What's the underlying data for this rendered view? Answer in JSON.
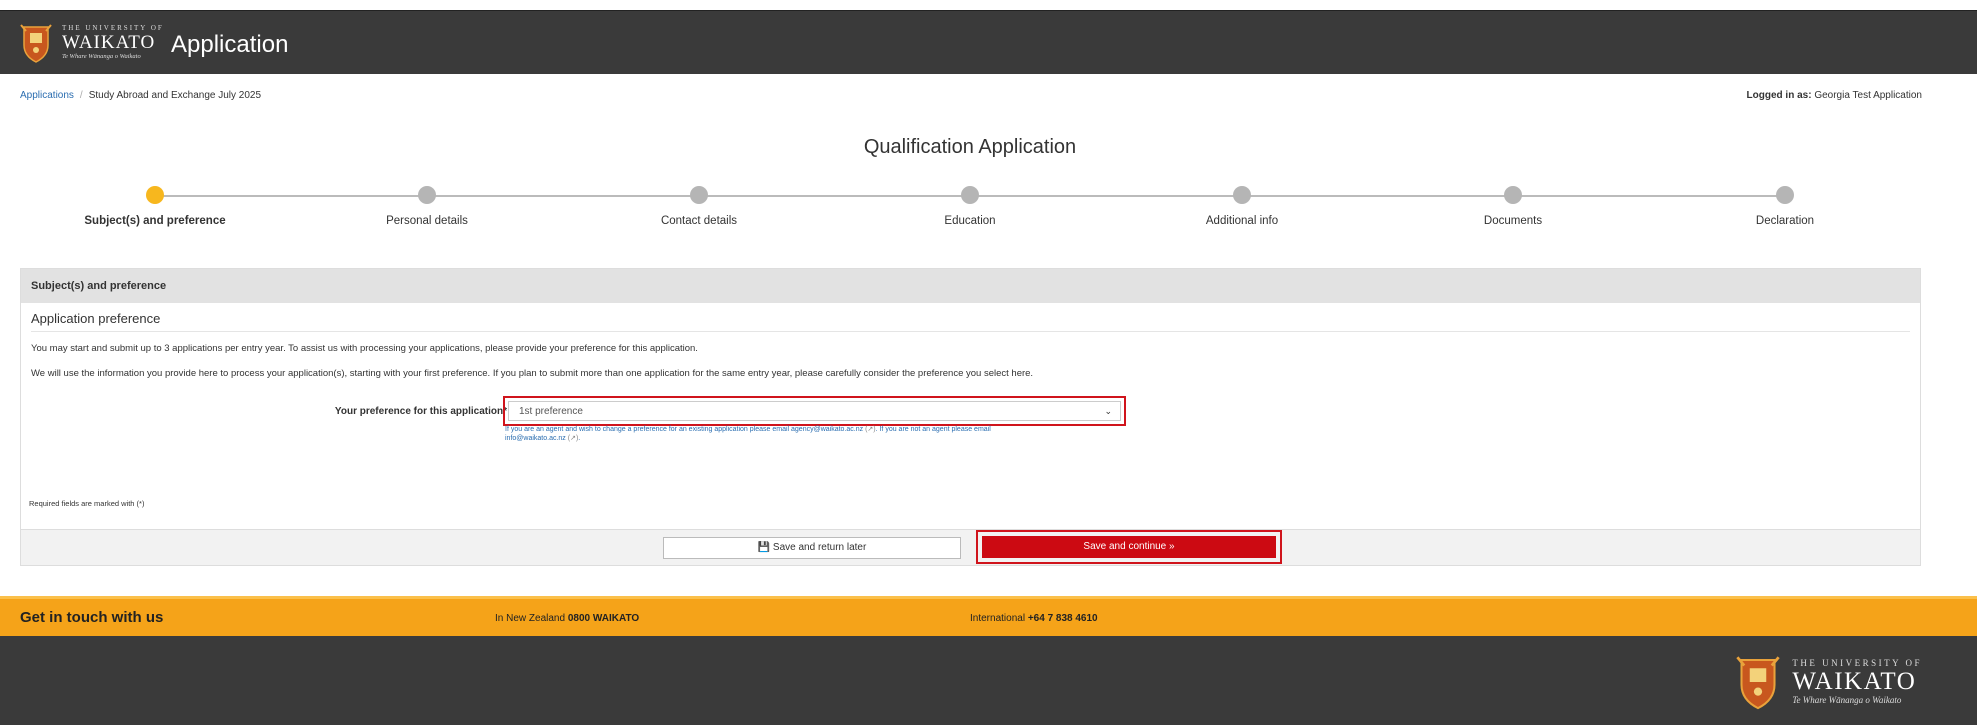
{
  "header": {
    "logo": {
      "small": "THE UNIVERSITY OF",
      "big": "WAIKATO",
      "motto": "Te Whare Wānanga o Waikato"
    },
    "title": "Application"
  },
  "breadcrumb": {
    "link": "Applications",
    "current": "Study Abroad and Exchange July 2025"
  },
  "logged_in": {
    "label": "Logged in as:",
    "name": "Georgia Test Application"
  },
  "page_title": "Qualification Application",
  "steps": [
    {
      "label": "Subject(s) and preference",
      "active": true
    },
    {
      "label": "Personal details",
      "active": false
    },
    {
      "label": "Contact details",
      "active": false
    },
    {
      "label": "Education",
      "active": false
    },
    {
      "label": "Additional info",
      "active": false
    },
    {
      "label": "Documents",
      "active": false
    },
    {
      "label": "Declaration",
      "active": false
    }
  ],
  "panel": {
    "heading": "Subject(s) and preference",
    "subheading": "Application preference",
    "para1": "You may start and submit up to 3 applications per entry year. To assist us with processing your applications, please provide your preference for this application.",
    "para2": "We will use the information you provide here to process your application(s), starting with your first preference. If you plan to submit more than one application for the same entry year, please carefully consider the preference you select here.",
    "pref_label": "Your preference for this application*",
    "pref_value": "1st preference",
    "help_text_1": "If you are an agent and wish to change a preference for an existing application please email agency@waikato.ac.nz",
    "help_icon": "(↗)",
    "help_text_2": ". If you are not an agent please email",
    "help_link": "info@waikato.ac.nz",
    "required_note": "Required fields are marked with (*)",
    "save_later": "Save and return later",
    "save_continue": "Save and continue »"
  },
  "footer": {
    "touch_title": "Get in touch with us",
    "nz_label": "In New Zealand",
    "nz_number": "0800 WAIKATO",
    "int_label": "International",
    "int_number": "+64 7 838 4610"
  },
  "colors": {
    "header_bg": "#3a3a3a",
    "accent": "#f7b71e",
    "primary_button": "#cc0a12",
    "footer_band": "#f5a319"
  }
}
